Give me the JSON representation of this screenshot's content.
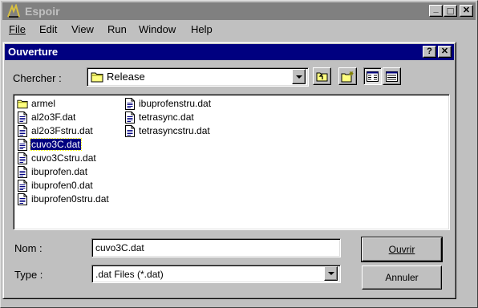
{
  "app": {
    "title": "Espoir",
    "minimize_glyph": "_",
    "maximize_glyph": "□",
    "close_glyph": "✕"
  },
  "menu": [
    {
      "label": "File"
    },
    {
      "label": "Edit"
    },
    {
      "label": "View"
    },
    {
      "label": "Run"
    },
    {
      "label": "Window"
    },
    {
      "label": "Help"
    }
  ],
  "dialog": {
    "title": "Ouverture",
    "help_glyph": "?",
    "close_glyph": "✕",
    "look_in_label": "Chercher :",
    "look_in_value": "Release",
    "files": [
      {
        "name": "armel",
        "icon": "folder-icon"
      },
      {
        "name": "al2o3F.dat",
        "icon": "file-icon"
      },
      {
        "name": "al2o3Fstru.dat",
        "icon": "file-icon"
      },
      {
        "name": "cuvo3C.dat",
        "icon": "file-icon",
        "selected": true
      },
      {
        "name": "cuvo3Cstru.dat",
        "icon": "file-icon"
      },
      {
        "name": "ibuprofen.dat",
        "icon": "file-icon"
      },
      {
        "name": "ibuprofen0.dat",
        "icon": "file-icon"
      },
      {
        "name": "ibuprofen0stru.dat",
        "icon": "file-icon"
      },
      {
        "name": "ibuprofenstru.dat",
        "icon": "file-icon"
      },
      {
        "name": "tetrasync.dat",
        "icon": "file-icon"
      },
      {
        "name": "tetrasyncstru.dat",
        "icon": "file-icon"
      }
    ],
    "name_label": "Nom :",
    "name_value": "cuvo3C.dat",
    "type_label": "Type :",
    "type_value": ".dat Files (*.dat)",
    "open_button": "Ouvrir",
    "cancel_button": "Annuler"
  },
  "colors": {
    "dialog_title_bg": "#000080",
    "app_title_bg": "#808080",
    "face": "#c0c0c0",
    "selection": "#000080"
  }
}
